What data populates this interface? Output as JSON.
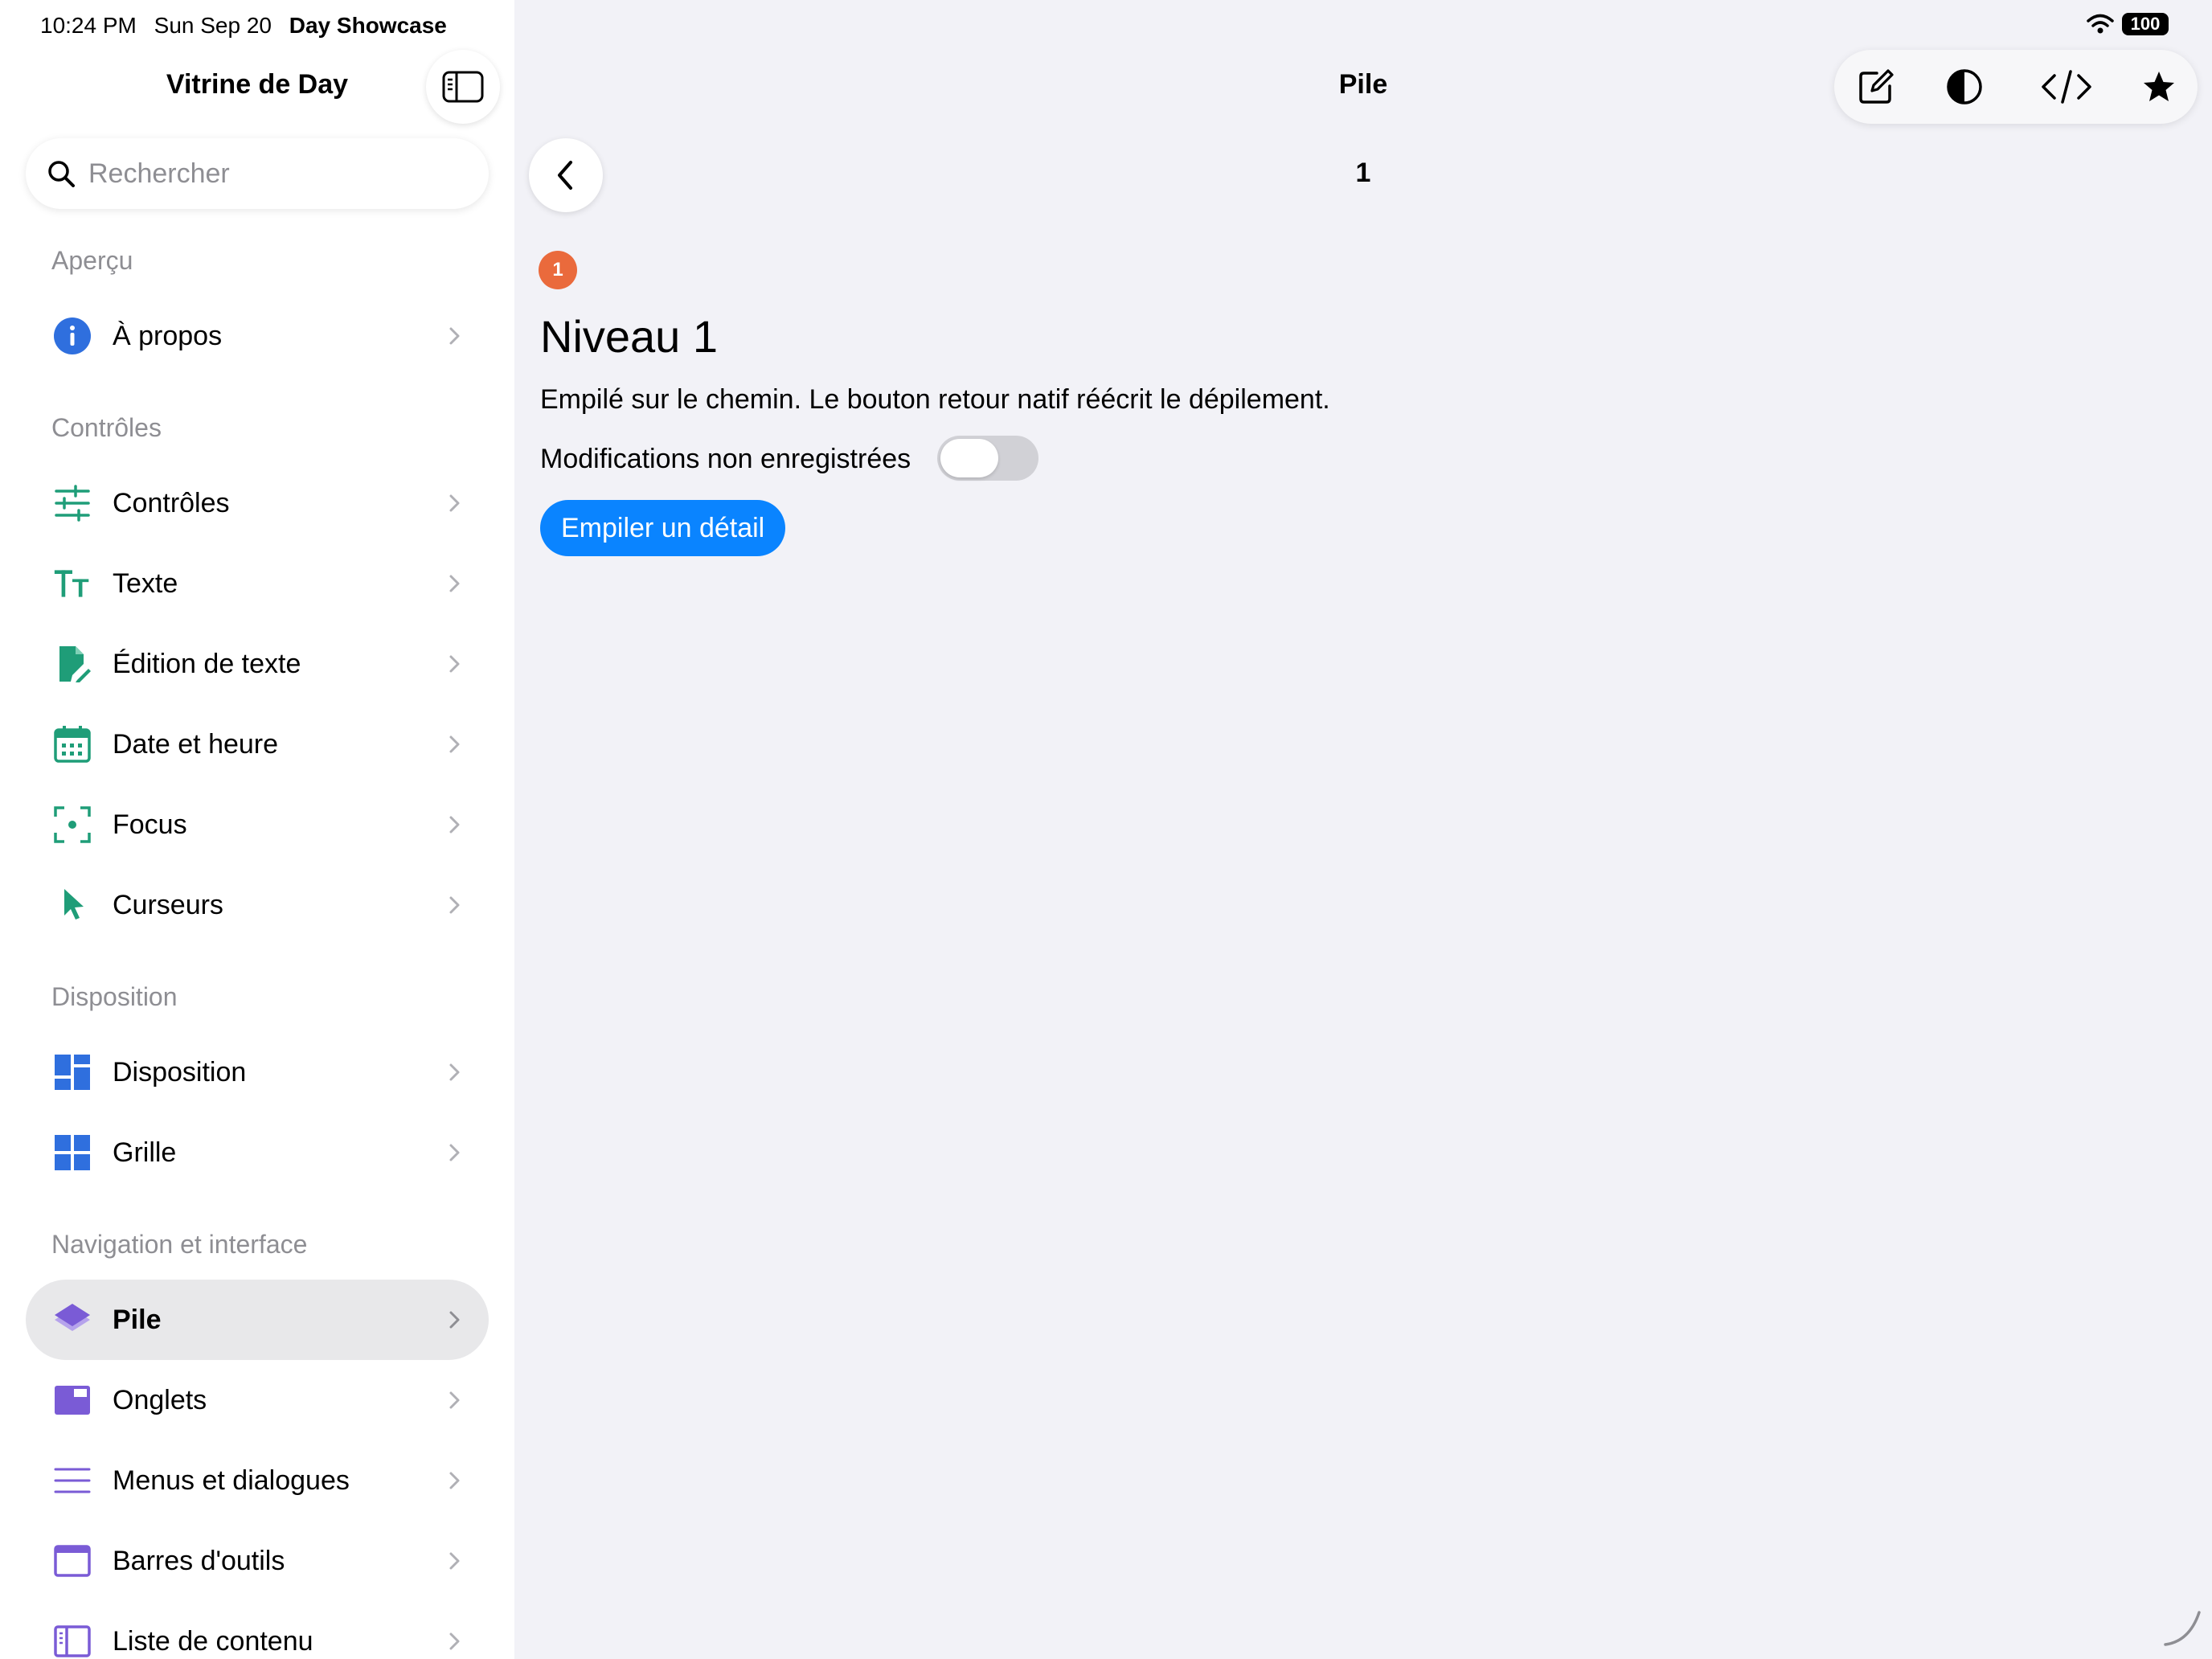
{
  "status": {
    "time": "10:24 PM",
    "date": "Sun Sep 20",
    "app_name": "Day Showcase",
    "battery": "100"
  },
  "sidebar": {
    "title": "Vitrine de Day",
    "search_placeholder": "Rechercher",
    "sections": [
      {
        "header": "Aperçu",
        "items": [
          {
            "label": "À propos",
            "icon": "info-icon",
            "color": "#2f6fde"
          }
        ]
      },
      {
        "header": "Contrôles",
        "items": [
          {
            "label": "Contrôles",
            "icon": "sliders-icon",
            "color": "#1f9d78"
          },
          {
            "label": "Texte",
            "icon": "text-size-icon",
            "color": "#1f9d78"
          },
          {
            "label": "Édition de texte",
            "icon": "document-edit-icon",
            "color": "#1f9d78"
          },
          {
            "label": "Date et heure",
            "icon": "calendar-icon",
            "color": "#1f9d78"
          },
          {
            "label": "Focus",
            "icon": "focus-icon",
            "color": "#1f9d78"
          },
          {
            "label": "Curseurs",
            "icon": "cursor-icon",
            "color": "#1f9d78"
          }
        ]
      },
      {
        "header": "Disposition",
        "items": [
          {
            "label": "Disposition",
            "icon": "layout-icon",
            "color": "#2f6fde"
          },
          {
            "label": "Grille",
            "icon": "grid-icon",
            "color": "#2f6fde"
          }
        ]
      },
      {
        "header": "Navigation et interface",
        "items": [
          {
            "label": "Pile",
            "icon": "stack-icon",
            "color": "#7a5bd6",
            "selected": true
          },
          {
            "label": "Onglets",
            "icon": "tabs-icon",
            "color": "#7a5bd6"
          },
          {
            "label": "Menus et dialogues",
            "icon": "menu-lines-icon",
            "color": "#7a5bd6"
          },
          {
            "label": "Barres d'outils",
            "icon": "window-toolbar-icon",
            "color": "#7a5bd6"
          },
          {
            "label": "Liste de contenu",
            "icon": "split-view-icon",
            "color": "#7a5bd6"
          }
        ]
      }
    ]
  },
  "main": {
    "title": "Pile",
    "toolbar_icons": [
      "compose-icon",
      "contrast-icon",
      "code-icon",
      "star-icon"
    ],
    "path_label": "1",
    "badge": "1",
    "heading": "Niveau 1",
    "description": "Empilé sur le chemin. Le bouton retour natif réécrit le dépilement.",
    "toggle_label": "Modifications non enregistrées",
    "toggle_on": false,
    "push_button": "Empiler un détail"
  },
  "colors": {
    "accent": "#0a84ff",
    "badge": "#ea6a3c",
    "selected_row": "#e8e8ea"
  }
}
